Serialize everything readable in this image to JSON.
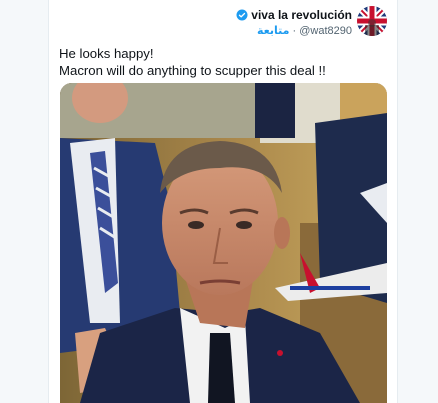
{
  "author": {
    "display_name": "viva la revolución",
    "handle": "@wat8290",
    "follow_label": "متابعة",
    "separator": "·"
  },
  "tweet": {
    "line1": "He looks happy!",
    "line2": "Macron will do anything to scupper this deal !!"
  },
  "media": {
    "description_icon": "photo"
  },
  "colors": {
    "accent": "#1d9bf0",
    "secondary_text": "#536471"
  }
}
